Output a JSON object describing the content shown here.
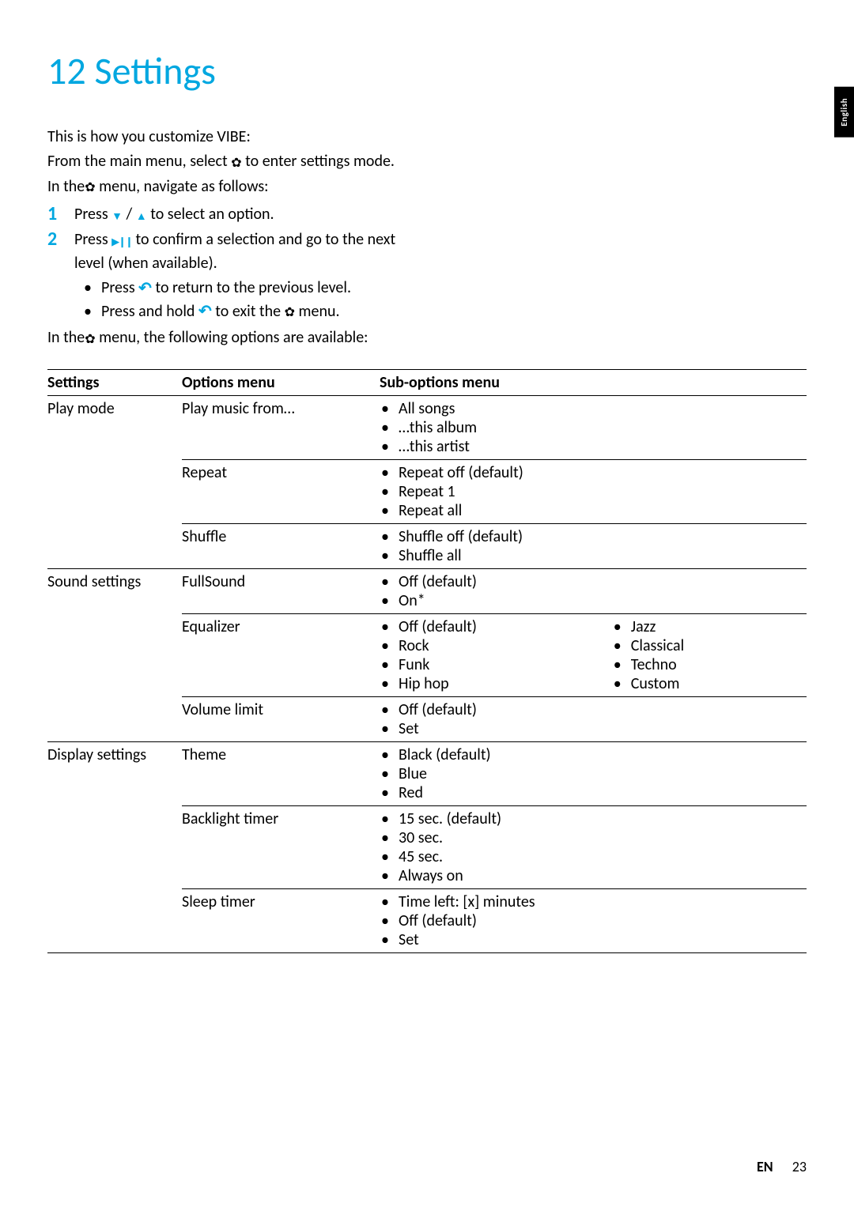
{
  "sideTab": "English",
  "title": "12 Settings",
  "intro": {
    "line1": "This is how you customize VIBE:",
    "line2a": "From the main menu, select ",
    "line2b": " to enter settings mode.",
    "line3a": "In the",
    "line3b": " menu, navigate as follows:"
  },
  "steps": {
    "s1_num": "1",
    "s1a": "Press ",
    "s1b": " / ",
    "s1c": " to select an option.",
    "s2_num": "2",
    "s2a": "Press ",
    "s2b": " to confirm a selection and go to the next level (when available).",
    "b1a": "Press ",
    "b1b": " to return to the previous level.",
    "b2a": "Press and hold ",
    "b2b": " to exit the ",
    "b2c": " menu."
  },
  "closing": {
    "a": "In the",
    "b": " menu, the following options are available:"
  },
  "table": {
    "headers": {
      "settings": "Settings",
      "options": "Options menu",
      "sub": "Sub-options menu"
    },
    "groups": [
      {
        "setting": "Play mode",
        "rows": [
          {
            "option": "Play music from…",
            "subs": [
              "All songs",
              "…this album",
              "…this artist"
            ]
          },
          {
            "option": "Repeat",
            "subs": [
              "Repeat off (default)",
              "Repeat 1",
              "Repeat all"
            ]
          },
          {
            "option": "Shuffle",
            "subs": [
              "Shuffle off (default)",
              "Shuffle all"
            ]
          }
        ]
      },
      {
        "setting": "Sound settings",
        "rows": [
          {
            "option": "FullSound",
            "subs": [
              "Off (default)",
              "On*"
            ]
          },
          {
            "option": "Equalizer",
            "subsA": [
              "Off (default)",
              "Rock",
              "Funk",
              "Hip hop"
            ],
            "subsB": [
              "Jazz",
              "Classical",
              "Techno",
              "Custom"
            ]
          },
          {
            "option": "Volume limit",
            "subs": [
              "Off (default)",
              "Set"
            ]
          }
        ]
      },
      {
        "setting": "Display settings",
        "rows": [
          {
            "option": "Theme",
            "subs": [
              "Black (default)",
              "Blue",
              "Red"
            ]
          },
          {
            "option": "Backlight timer",
            "subs": [
              "15 sec. (default)",
              "30 sec.",
              "45 sec.",
              "Always on"
            ]
          },
          {
            "option": "Sleep timer",
            "subs": [
              "Time left: [x] minutes",
              "Off (default)",
              "Set"
            ]
          }
        ]
      }
    ]
  },
  "footer": {
    "lang": "EN",
    "page": "23"
  }
}
